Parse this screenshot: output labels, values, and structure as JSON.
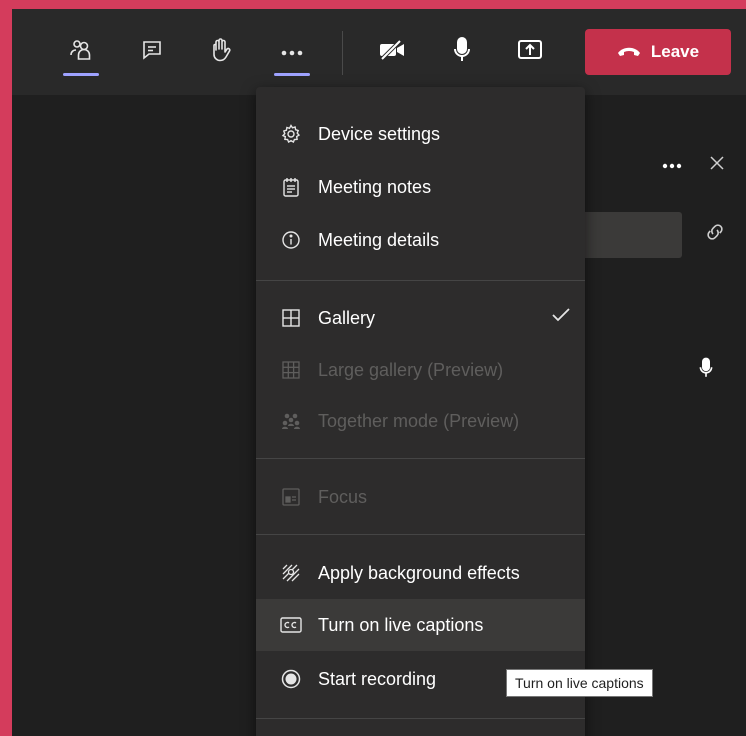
{
  "toolbar": {
    "buttons": [
      {
        "name": "participants",
        "icon": "people-icon",
        "underlined": true
      },
      {
        "name": "chat",
        "icon": "chat-icon",
        "underlined": false
      },
      {
        "name": "raise-hand",
        "icon": "hand-icon",
        "underlined": false
      },
      {
        "name": "more-actions",
        "icon": "more-icon",
        "underlined": true
      },
      {
        "name": "camera",
        "icon": "camera-off-icon"
      },
      {
        "name": "mic",
        "icon": "mic-icon"
      },
      {
        "name": "share",
        "icon": "share-screen-icon"
      }
    ],
    "leave_label": "Leave"
  },
  "menu": {
    "items": [
      {
        "label": "Device settings",
        "icon": "gear-icon",
        "disabled": false
      },
      {
        "label": "Meeting notes",
        "icon": "notes-icon",
        "disabled": false
      },
      {
        "label": "Meeting details",
        "icon": "info-icon",
        "disabled": false
      },
      {
        "label": "Gallery",
        "icon": "gallery-icon",
        "disabled": false,
        "checked": true
      },
      {
        "label": "Large gallery (Preview)",
        "icon": "large-gallery-icon",
        "disabled": true
      },
      {
        "label": "Together mode (Preview)",
        "icon": "together-mode-icon",
        "disabled": true
      },
      {
        "label": "Focus",
        "icon": "focus-icon",
        "disabled": true
      },
      {
        "label": "Apply background effects",
        "icon": "background-effects-icon",
        "disabled": false
      },
      {
        "label": "Turn on live captions",
        "icon": "captions-icon",
        "disabled": false,
        "hovered": true
      },
      {
        "label": "Start recording",
        "icon": "record-icon",
        "disabled": false
      }
    ]
  },
  "tooltip": {
    "text": "Turn on live captions"
  },
  "colors": {
    "frame_border": "#d43c5c",
    "leave_button": "#c4314b",
    "accent_underline": "#9ea2ff",
    "menu_bg": "#2d2c2c",
    "toolbar_bg": "#292929"
  }
}
